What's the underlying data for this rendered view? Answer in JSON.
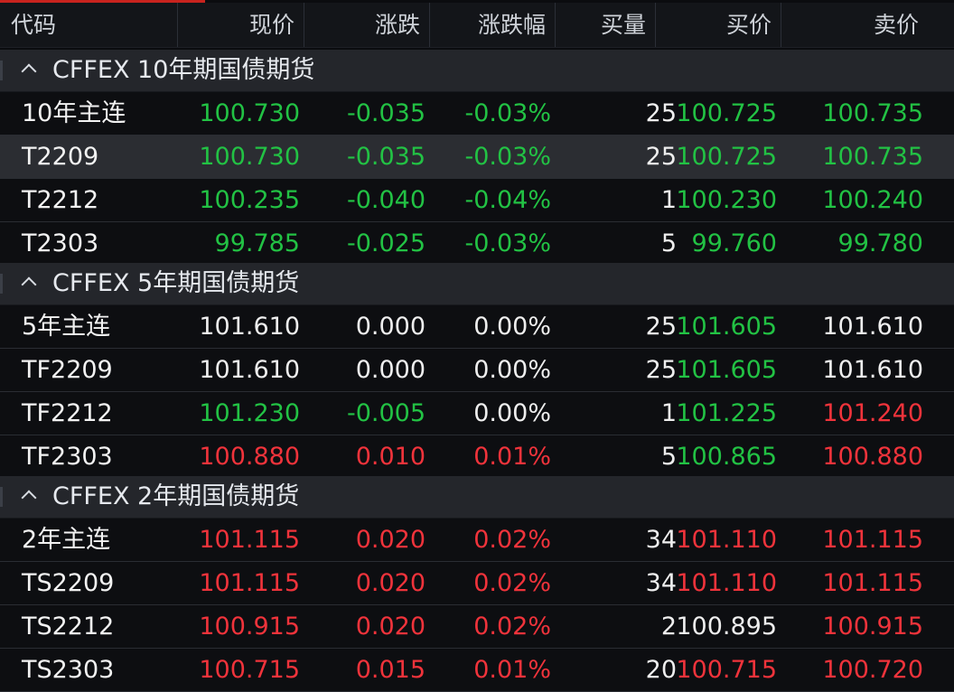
{
  "columns": [
    "代码",
    "现价",
    "涨跌",
    "涨跌幅",
    "买量",
    "买价",
    "卖价"
  ],
  "colors": {
    "up": "#f0333b",
    "down": "#22c244",
    "flat": "#eeeeee"
  },
  "groups": [
    {
      "title": "CFFEX 10年期国债期货",
      "icon": "chevron-up-icon",
      "rows": [
        {
          "code": "10年主连",
          "price": "100.730",
          "change": "-0.035",
          "pct": "-0.03%",
          "bid_vol": "25",
          "bid": "100.725",
          "ask": "100.735",
          "c": [
            "green",
            "green",
            "green",
            "white",
            "green",
            "green"
          ]
        },
        {
          "code": "T2209",
          "price": "100.730",
          "change": "-0.035",
          "pct": "-0.03%",
          "bid_vol": "25",
          "bid": "100.725",
          "ask": "100.735",
          "c": [
            "green",
            "green",
            "green",
            "white",
            "green",
            "green"
          ],
          "selected": true
        },
        {
          "code": "T2212",
          "price": "100.235",
          "change": "-0.040",
          "pct": "-0.04%",
          "bid_vol": "1",
          "bid": "100.230",
          "ask": "100.240",
          "c": [
            "green",
            "green",
            "green",
            "white",
            "green",
            "green"
          ]
        },
        {
          "code": "T2303",
          "price": "99.785",
          "change": "-0.025",
          "pct": "-0.03%",
          "bid_vol": "5",
          "bid": "99.760",
          "ask": "99.780",
          "c": [
            "green",
            "green",
            "green",
            "white",
            "green",
            "green"
          ]
        }
      ]
    },
    {
      "title": "CFFEX 5年期国债期货",
      "icon": "chevron-up-icon",
      "rows": [
        {
          "code": "5年主连",
          "price": "101.610",
          "change": "0.000",
          "pct": "0.00%",
          "bid_vol": "25",
          "bid": "101.605",
          "ask": "101.610",
          "c": [
            "white",
            "white",
            "white",
            "white",
            "green",
            "white"
          ]
        },
        {
          "code": "TF2209",
          "price": "101.610",
          "change": "0.000",
          "pct": "0.00%",
          "bid_vol": "25",
          "bid": "101.605",
          "ask": "101.610",
          "c": [
            "white",
            "white",
            "white",
            "white",
            "green",
            "white"
          ]
        },
        {
          "code": "TF2212",
          "price": "101.230",
          "change": "-0.005",
          "pct": "0.00%",
          "bid_vol": "1",
          "bid": "101.225",
          "ask": "101.240",
          "c": [
            "green",
            "green",
            "white",
            "white",
            "green",
            "red"
          ]
        },
        {
          "code": "TF2303",
          "price": "100.880",
          "change": "0.010",
          "pct": "0.01%",
          "bid_vol": "5",
          "bid": "100.865",
          "ask": "100.880",
          "c": [
            "red",
            "red",
            "red",
            "white",
            "green",
            "red"
          ]
        }
      ]
    },
    {
      "title": "CFFEX 2年期国债期货",
      "icon": "chevron-up-icon",
      "rows": [
        {
          "code": "2年主连",
          "price": "101.115",
          "change": "0.020",
          "pct": "0.02%",
          "bid_vol": "34",
          "bid": "101.110",
          "ask": "101.115",
          "c": [
            "red",
            "red",
            "red",
            "white",
            "red",
            "red"
          ]
        },
        {
          "code": "TS2209",
          "price": "101.115",
          "change": "0.020",
          "pct": "0.02%",
          "bid_vol": "34",
          "bid": "101.110",
          "ask": "101.115",
          "c": [
            "red",
            "red",
            "red",
            "white",
            "red",
            "red"
          ]
        },
        {
          "code": "TS2212",
          "price": "100.915",
          "change": "0.020",
          "pct": "0.02%",
          "bid_vol": "2",
          "bid": "100.895",
          "ask": "100.915",
          "c": [
            "red",
            "red",
            "red",
            "white",
            "white",
            "red"
          ]
        },
        {
          "code": "TS2303",
          "price": "100.715",
          "change": "0.015",
          "pct": "0.01%",
          "bid_vol": "20",
          "bid": "100.715",
          "ask": "100.720",
          "c": [
            "red",
            "red",
            "red",
            "white",
            "red",
            "red"
          ]
        }
      ]
    }
  ]
}
